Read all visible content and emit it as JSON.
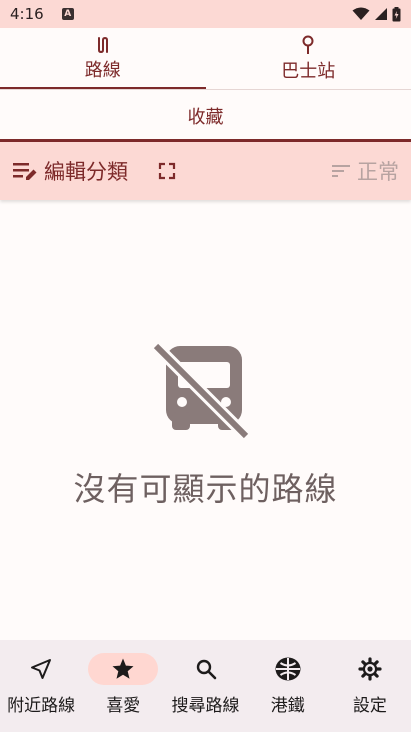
{
  "status_bar": {
    "time": "4:16",
    "app_icon_letter": "A",
    "icons": [
      "wifi-icon",
      "signal-icon",
      "battery-icon"
    ]
  },
  "top_tabs": [
    {
      "label": "路線",
      "icon": "route-icon",
      "active": true
    },
    {
      "label": "巴士站",
      "icon": "bus-stop-pin-icon",
      "active": false
    }
  ],
  "category_tab": {
    "label": "收藏"
  },
  "toolbar": {
    "edit_label": "編輯分類",
    "sort_label": "正常"
  },
  "empty_state": {
    "icon": "bus-off-icon",
    "message": "沒有可顯示的路線"
  },
  "bottom_nav": [
    {
      "label": "附近路線",
      "icon": "near-me-icon",
      "active": false
    },
    {
      "label": "喜愛",
      "icon": "star-icon",
      "active": true
    },
    {
      "label": "搜尋路線",
      "icon": "search-icon",
      "active": false
    },
    {
      "label": "港鐵",
      "icon": "mtr-logo-icon",
      "active": false
    },
    {
      "label": "設定",
      "icon": "gear-icon",
      "active": false
    }
  ],
  "colors": {
    "accent": "#7d2a2a",
    "status_bar_bg": "#fcd9d4",
    "toolbar_bg": "#fcd9d4",
    "nav_bg": "#f3ecef",
    "nav_active_pill": "#ffd7d1",
    "empty_icon": "#8a7b7a"
  }
}
